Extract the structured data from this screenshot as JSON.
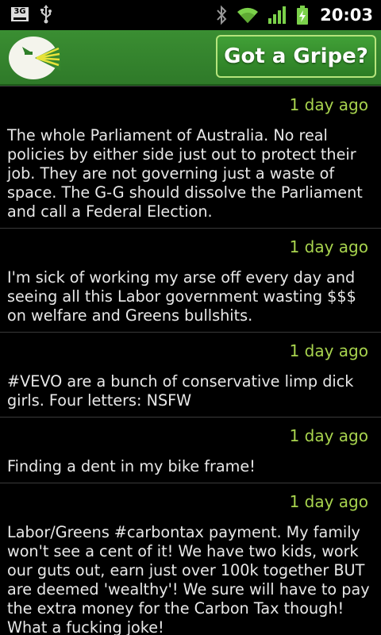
{
  "status_bar": {
    "network_label": "3G",
    "time": "20:03",
    "icons": [
      "3g-icon",
      "usb-icon",
      "bluetooth-icon",
      "wifi-icon",
      "signal-icon",
      "battery-charging-icon"
    ],
    "colors": {
      "wifi": "#7bd14a",
      "signal": "#7bd14a",
      "battery": "#7bd14a"
    }
  },
  "header": {
    "logo_icon": "gripe-logo-icon",
    "button_label": "Got a Gripe?",
    "bg_color": "#34862d",
    "button_border_color": "#b6e47c"
  },
  "accent_color": "#a8d44e",
  "posts": [
    {
      "time": "1 day ago",
      "text": "The whole Parliament of Australia. No real policies by either side just out to protect their job. They are not governing just a waste of space. The G-G should dissolve the Parliament and call a Federal Election."
    },
    {
      "time": "1 day ago",
      "text": "I'm sick of working my arse off every day and seeing all this Labor government wasting $$$ on welfare and Greens bullshits."
    },
    {
      "time": "1 day ago",
      "text": "#VEVO are a bunch of conservative limp dick girls. Four letters: NSFW"
    },
    {
      "time": "1 day ago",
      "text": "Finding a dent in my bike frame!"
    },
    {
      "time": "1 day ago",
      "text": "Labor/Greens #carbontax payment. My family won't see a cent of it! We have two kids, work our guts out, earn just over 100k together BUT are deemed 'wealthy'! We sure will have to pay the extra money for the Carbon Tax though! What a fucking joke!"
    }
  ]
}
